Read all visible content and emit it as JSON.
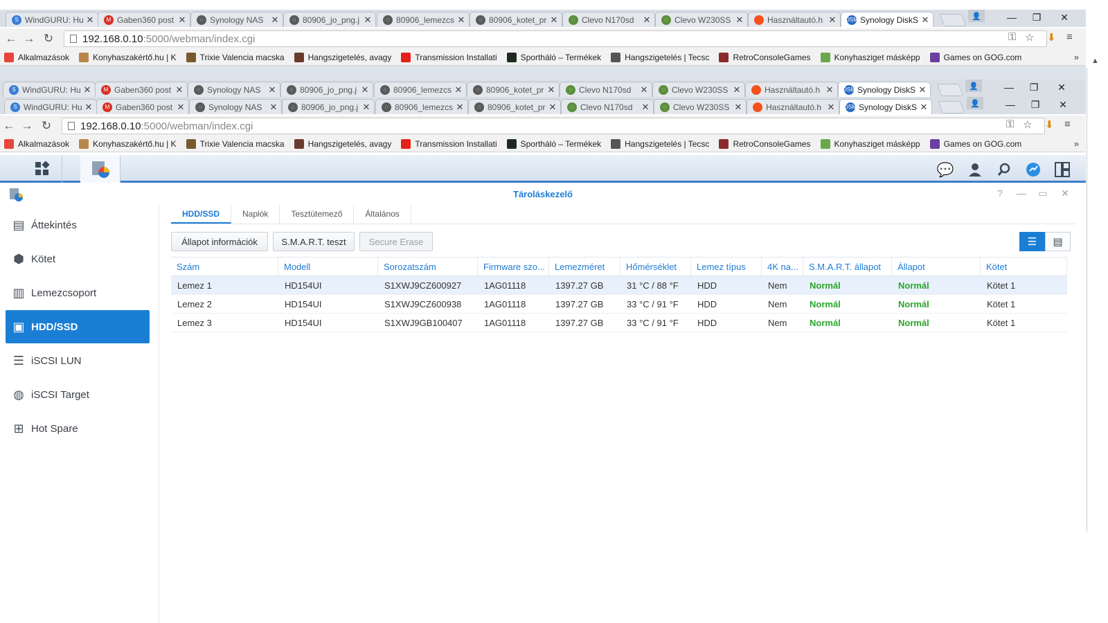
{
  "browser": {
    "tabs": [
      {
        "title": "WindGURU: Hu",
        "color": "#3b7dd8",
        "glyph": "S"
      },
      {
        "title": "Gaben360 post",
        "color": "#d93025",
        "glyph": "M"
      },
      {
        "title": "Synology NAS",
        "color": "#5a5a5a",
        "glyph": "◌"
      },
      {
        "title": "80906_jo_png.j",
        "color": "#5a5a5a",
        "glyph": "◌"
      },
      {
        "title": "80906_lemezcs",
        "color": "#5a5a5a",
        "glyph": "◌"
      },
      {
        "title": "80906_kotet_pr",
        "color": "#5a5a5a",
        "glyph": "◌"
      },
      {
        "title": "Clevo N170sd",
        "color": "#5b8f3c",
        "glyph": "◌"
      },
      {
        "title": "Clevo W230SS",
        "color": "#5b8f3c",
        "glyph": "◌"
      },
      {
        "title": "Használtautó.h",
        "color": "#f4511e",
        "glyph": ""
      },
      {
        "title": "Synology DiskS",
        "color": "#2b6cc4",
        "glyph": "DSM"
      }
    ],
    "url_host": "192.168.0.10",
    "url_rest": ":5000/webman/index.cgi",
    "bookmarks": [
      {
        "label": "Alkalmazások",
        "color": "#e8453c"
      },
      {
        "label": "Konyhaszakértő.hu | K",
        "color": "#b8864b"
      },
      {
        "label": "Trixie Valencia macska",
        "color": "#7a5a2c"
      },
      {
        "label": "Hangszigetelés, avagy",
        "color": "#6b3b2a"
      },
      {
        "label": "Transmission Installati",
        "color": "#e62117"
      },
      {
        "label": "Sportháló – Termékek",
        "color": "#1f2a1f"
      },
      {
        "label": "Hangszigetelés | Tecsc",
        "color": "#555555"
      },
      {
        "label": "RetroConsoleGames",
        "color": "#8b2b2b"
      },
      {
        "label": "Konyhasziget másképp",
        "color": "#6aa84f"
      },
      {
        "label": "Games on GOG.com",
        "color": "#6b3fa0"
      }
    ],
    "more_symbol": "»"
  },
  "window": {
    "title": "Tároláskezelő",
    "help_symbol": "?",
    "min_symbol": "—",
    "max_symbol": "▭",
    "close_symbol": "✕"
  },
  "sidebar": {
    "items": [
      {
        "label": "Áttekintés",
        "icon": "overview-icon",
        "glyph": "▤",
        "active": false
      },
      {
        "label": "Kötet",
        "icon": "volume-icon",
        "glyph": "⬢",
        "active": false
      },
      {
        "label": "Lemezcsoport",
        "icon": "disk-group-icon",
        "glyph": "▥",
        "active": false
      },
      {
        "label": "HDD/SSD",
        "icon": "hdd-icon",
        "glyph": "▣",
        "active": true
      },
      {
        "label": "iSCSI LUN",
        "icon": "iscsi-lun-icon",
        "glyph": "☰",
        "active": false
      },
      {
        "label": "iSCSI Target",
        "icon": "iscsi-target-icon",
        "glyph": "◍",
        "active": false
      },
      {
        "label": "Hot Spare",
        "icon": "hot-spare-icon",
        "glyph": "⊞",
        "active": false
      }
    ]
  },
  "main": {
    "tabs": [
      "HDD/SSD",
      "Naplók",
      "Tesztütemező",
      "Általános"
    ],
    "buttons": {
      "status_info": "Állapot információk",
      "smart_test": "S.M.A.R.T. teszt",
      "secure_erase": "Secure Erase"
    },
    "columns": [
      "Szám",
      "Modell",
      "Sorozatszám",
      "Firmware szo...",
      "Lemezméret",
      "Hőmérséklet",
      "Lemez típus",
      "4K na...",
      "S.M.A.R.T. állapot",
      "Állapot",
      "Kötet"
    ],
    "rows": [
      [
        "Lemez 1",
        "HD154UI",
        "S1XWJ9CZ600927",
        "1AG01118",
        "1397.27 GB",
        "31 °C / 88 °F",
        "HDD",
        "Nem",
        "Normál",
        "Normál",
        "Kötet 1"
      ],
      [
        "Lemez 2",
        "HD154UI",
        "S1XWJ9CZ600938",
        "1AG01118",
        "1397.27 GB",
        "33 °C / 91 °F",
        "HDD",
        "Nem",
        "Normál",
        "Normál",
        "Kötet 1"
      ],
      [
        "Lemez 3",
        "HD154UI",
        "S1XWJ9GB100407",
        "1AG01118",
        "1397.27 GB",
        "33 °C / 91 °F",
        "HDD",
        "Nem",
        "Normál",
        "Normál",
        "Kötet 1"
      ]
    ]
  },
  "colors": {
    "accent": "#1a7fd4",
    "ok": "#2aa52a"
  }
}
